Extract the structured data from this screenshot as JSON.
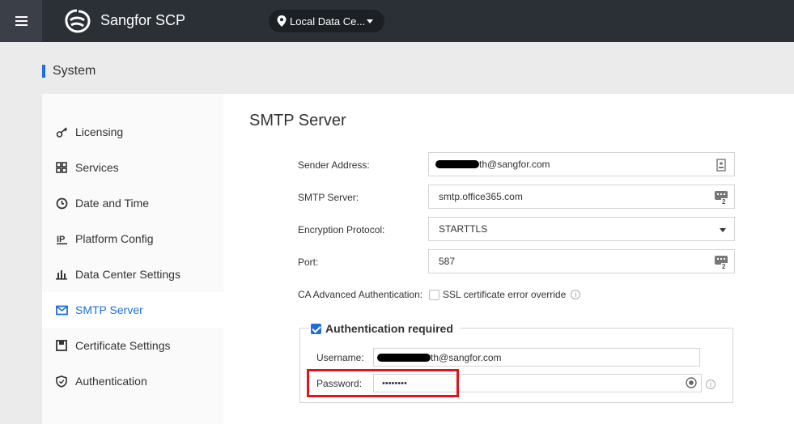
{
  "header": {
    "app_title": "Sangfor SCP",
    "menu_icon": "hamburger-icon",
    "logo_icon": "sangfor-logo-icon",
    "location_label": "Local Data Ce...",
    "location_icon": "location-pin-icon"
  },
  "breadcrumb": {
    "title": "System"
  },
  "sidebar": {
    "items": [
      {
        "label": "Licensing",
        "icon": "key-icon"
      },
      {
        "label": "Services",
        "icon": "grid-icon"
      },
      {
        "label": "Date and Time",
        "icon": "clock-icon"
      },
      {
        "label": "Platform Config",
        "icon": "ip-icon"
      },
      {
        "label": "Data Center Settings",
        "icon": "bar-chart-icon"
      },
      {
        "label": "SMTP Server",
        "icon": "mail-icon",
        "active": true
      },
      {
        "label": "Certificate Settings",
        "icon": "save-icon"
      },
      {
        "label": "Authentication",
        "icon": "shield-icon"
      }
    ]
  },
  "main": {
    "title": "SMTP Server",
    "sender_address": {
      "label": "Sender Address:",
      "value": "th@sangfor.com"
    },
    "smtp_server": {
      "label": "SMTP Server:",
      "value": "smtp.office365.com"
    },
    "encryption": {
      "label": "Encryption Protocol:",
      "value": "STARTTLS"
    },
    "port": {
      "label": "Port:",
      "value": "587"
    },
    "ca_auth": {
      "label": "CA Advanced Authentication:",
      "option": "SSL certificate error override",
      "checked": false
    },
    "auth": {
      "title": "Authentication required",
      "checked": true,
      "username_label": "Username:",
      "username_value": "th@sangfor.com",
      "password_label": "Password:",
      "password_value": "••••••••"
    }
  },
  "colors": {
    "accent": "#1e6fd9",
    "topbar": "#2b2f36",
    "highlight": "#e0141e"
  }
}
